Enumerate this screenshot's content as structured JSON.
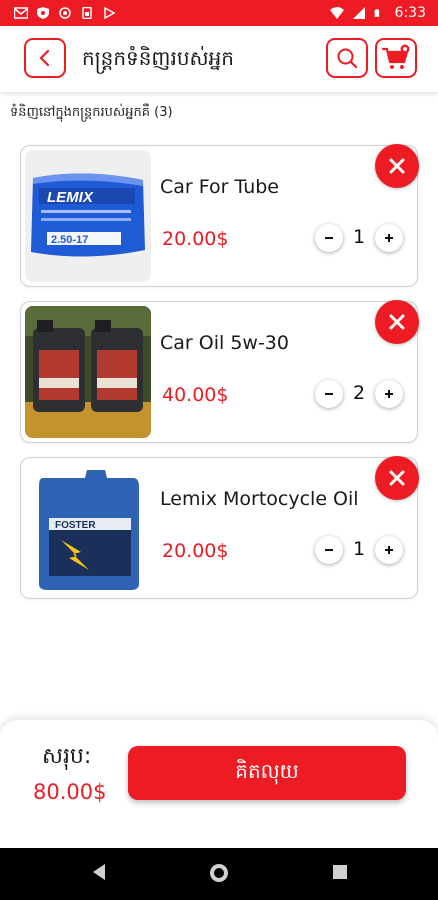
{
  "status_bar": {
    "time": "6:33",
    "icons_left": [
      "gmail-icon",
      "shield-icon",
      "circle-icon",
      "sim-icon",
      "play-store-icon"
    ],
    "icons_right": [
      "wifi-icon",
      "signal-icon",
      "battery-icon"
    ]
  },
  "header": {
    "title": "កន្ត្រកទំនិញរបស់អ្នក",
    "back_icon": "chevron-left-icon",
    "search_icon": "search-icon",
    "cart_icon": "cart-icon"
  },
  "items_count_label": "ទំនិញនៅក្នុងកន្ត្រករបស់អ្នកគឺ (3)",
  "cart_items": [
    {
      "name": "Car For Tube",
      "price": "20.00$",
      "qty": "1",
      "image_text": "LEMIX",
      "image_subtext": "2.50-17"
    },
    {
      "name": "Car Oil 5w-30",
      "price": "40.00$",
      "qty": "2"
    },
    {
      "name": "Lemix Mortocycle Oil",
      "price": "20.00$",
      "qty": "1",
      "image_text": "FOSTER"
    }
  ],
  "footer": {
    "total_label": "សរុប:",
    "total_value": "80.00$",
    "checkout_label": "គិតលុយ"
  },
  "nav": {
    "back_icon": "back-triangle-icon",
    "home_icon": "home-circle-icon",
    "recents_icon": "recents-square-icon"
  },
  "colors": {
    "accent": "#ed1c24",
    "text": "#1a1a1a",
    "border": "#cfcfcf"
  }
}
